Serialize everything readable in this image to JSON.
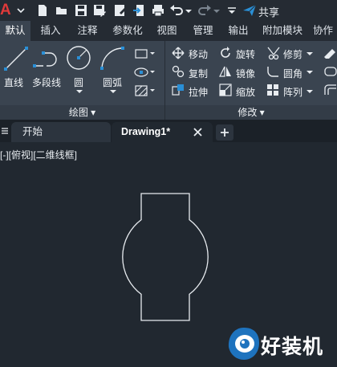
{
  "qat": {
    "logo": "A",
    "share_label": "共享",
    "icons": [
      "new-file-icon",
      "open-folder-icon",
      "save-icon",
      "save-as-icon",
      "share-drawing-icon",
      "import-icon",
      "print-icon",
      "undo-icon",
      "undo-dropdown-icon",
      "redo-icon",
      "redo-dropdown-icon",
      "qat-dropdown-icon",
      "share-icon"
    ]
  },
  "ribbon_tabs": [
    "默认",
    "插入",
    "注释",
    "参数化",
    "视图",
    "管理",
    "输出",
    "附加模块",
    "协作"
  ],
  "active_tab": "默认",
  "draw_panel": {
    "tools": {
      "line": "直线",
      "polyline": "多段线",
      "circle": "圆",
      "arc": "圆弧"
    },
    "title": "绘图"
  },
  "modify_panel": {
    "tools": {
      "move": "移动",
      "rotate": "旋转",
      "trim": "修剪",
      "copy": "复制",
      "mirror": "镜像",
      "fillet": "圆角",
      "stretch": "拉伸",
      "scale": "缩放",
      "array": "阵列"
    },
    "title": "修改"
  },
  "doc_tabs": [
    {
      "label": "开始",
      "active": false
    },
    {
      "label": "Drawing1*",
      "active": true
    }
  ],
  "viewport_label": "[-][俯视][二维线框]",
  "watermark": {
    "text": "好装机"
  },
  "colors": {
    "background": "#212830",
    "ribbon": "#3a4450",
    "accent_blue": "#2a8fd6",
    "logo_red": "#e03a3a"
  }
}
